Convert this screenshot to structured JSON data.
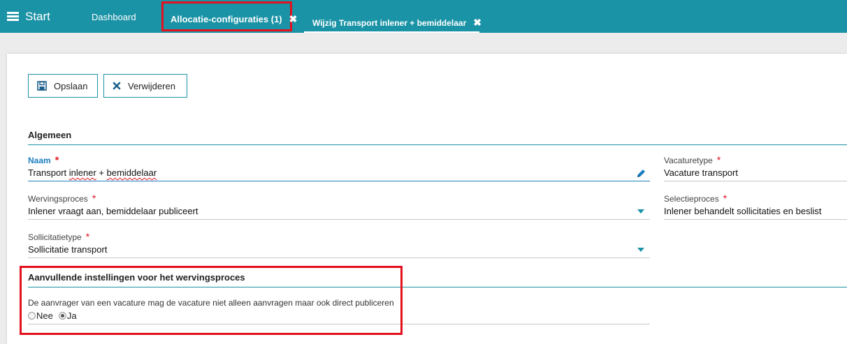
{
  "topbar": {
    "menu_label": "Start",
    "tabs": [
      {
        "label": "Dashboard"
      },
      {
        "label": "Allocatie-configuraties (1)",
        "close": "✖"
      },
      {
        "label": "Wijzig Transport inlener + bemiddelaar",
        "close": "✖"
      }
    ]
  },
  "toolbar": {
    "save_label": "Opslaan",
    "delete_label": "Verwijderen"
  },
  "general": {
    "title": "Algemeen",
    "naam_label": "Naam",
    "naam_value_parts": [
      "Transport ",
      "inlener",
      " + ",
      "bemiddelaar"
    ],
    "vacaturetype_label": "Vacaturetype",
    "vacaturetype_value": "Vacature transport",
    "wervingsproces_label": "Wervingsproces",
    "wervingsproces_value": "Inlener vraagt aan, bemiddelaar publiceert",
    "selectieproces_label": "Selectieproces",
    "selectieproces_value": "Inlener behandelt sollicitaties en beslist",
    "sollicitatietype_label": "Sollicitatietype",
    "sollicitatietype_value": "Sollicitatie transport",
    "required_marker": "*"
  },
  "extra": {
    "title": "Aanvullende instellingen voor het wervingsproces",
    "question": "De aanvrager van een vacature mag de vacature niet alleen aanvragen maar ook direct publiceren",
    "option_no": "Nee",
    "option_yes": "Ja",
    "selected": "Ja"
  },
  "colors": {
    "accent": "#1b93a6",
    "highlight": "#e3101e",
    "focus": "#1b7ec0"
  }
}
